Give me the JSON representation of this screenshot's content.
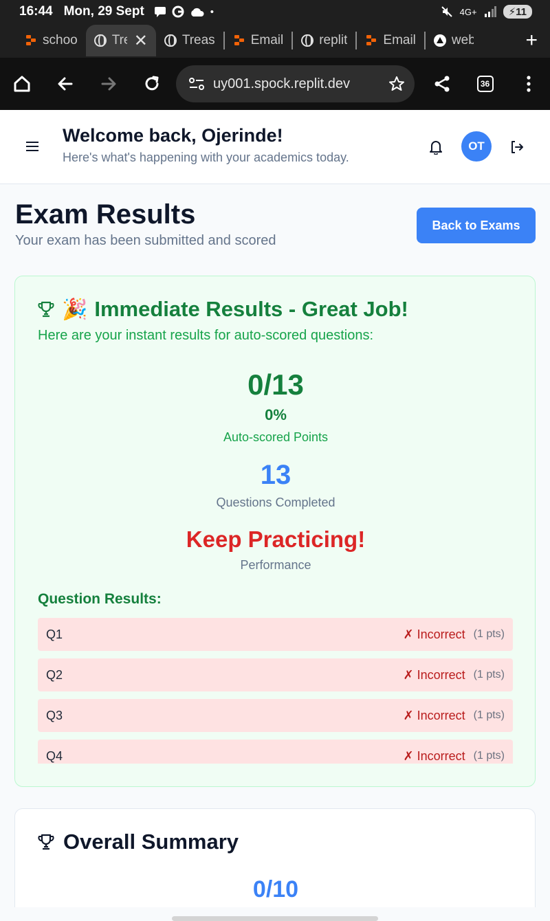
{
  "status_bar": {
    "time": "16:44",
    "date": "Mon, 29 Sept",
    "network": "4G+",
    "battery": "11"
  },
  "tabs": [
    {
      "label": "schoo",
      "icon": "replit-icon",
      "active": false
    },
    {
      "label": "Tre",
      "icon": "globe-icon",
      "active": true
    },
    {
      "label": "Treas",
      "icon": "globe-icon",
      "active": false
    },
    {
      "label": "Email",
      "icon": "replit-icon",
      "active": false
    },
    {
      "label": "replit",
      "icon": "globe-icon",
      "active": false
    },
    {
      "label": "Email",
      "icon": "replit-icon",
      "active": false
    },
    {
      "label": "web",
      "icon": "triangle-icon",
      "active": false
    }
  ],
  "browser": {
    "url": "uy001.spock.replit.dev",
    "tab_count": "36"
  },
  "header": {
    "welcome": "Welcome back, Ojerinde!",
    "subtitle": "Here's what's happening with your academics today.",
    "avatar_initials": "OT"
  },
  "page": {
    "title": "Exam Results",
    "subtitle": "Your exam has been submitted and scored",
    "back_button": "Back to Exams"
  },
  "results": {
    "heading": "Immediate Results - Great Job!",
    "party_emoji": "🎉",
    "subheading": "Here are your instant results for auto-scored questions:",
    "score": "0/13",
    "percent": "0%",
    "score_label": "Auto-scored Points",
    "completed": "13",
    "completed_label": "Questions Completed",
    "performance": "Keep Practicing!",
    "performance_label": "Performance",
    "question_results_title": "Question Results:",
    "questions": [
      {
        "label": "Q1",
        "status": "✗ Incorrect",
        "points": "(1 pts)"
      },
      {
        "label": "Q2",
        "status": "✗ Incorrect",
        "points": "(1 pts)"
      },
      {
        "label": "Q3",
        "status": "✗ Incorrect",
        "points": "(1 pts)"
      },
      {
        "label": "Q4",
        "status": "✗ Incorrect",
        "points": "(1 pts)"
      }
    ]
  },
  "summary": {
    "heading": "Overall Summary",
    "score": "0/10"
  },
  "colors": {
    "accent": "#3b82f6",
    "success": "#15803d",
    "danger": "#dc2626",
    "incorrect_bg": "#fee2e2",
    "card_bg": "#f0fdf4"
  }
}
